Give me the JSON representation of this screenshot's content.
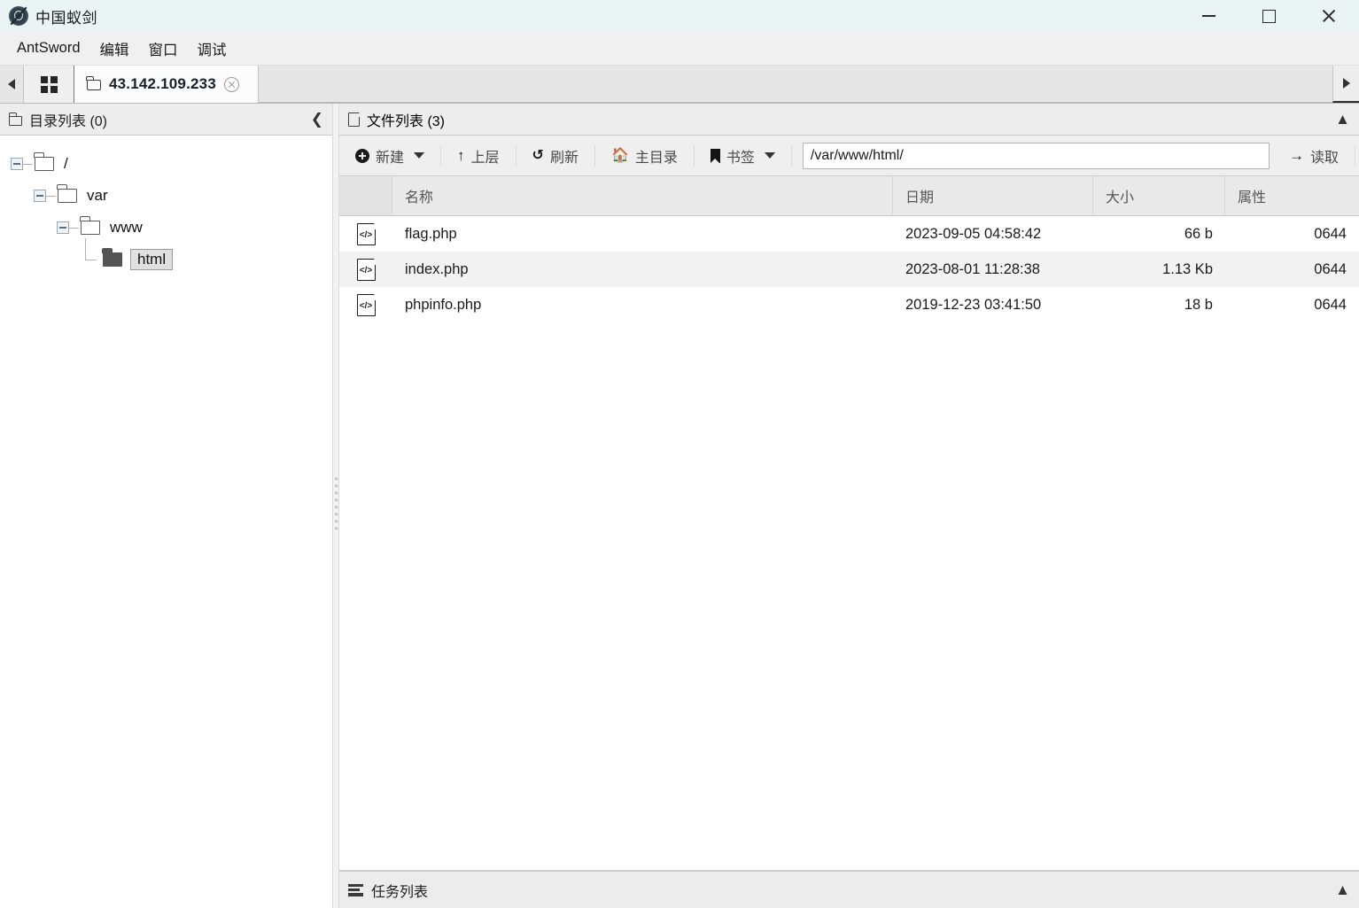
{
  "window": {
    "title": "中国蚁剑",
    "app_icon": "antsword-logo-icon",
    "minimize_label": "最小化",
    "maximize_label": "最大化",
    "close_label": "关闭"
  },
  "menubar": {
    "items": [
      {
        "label": "AntSword"
      },
      {
        "label": "编辑"
      },
      {
        "label": "窗口"
      },
      {
        "label": "调试"
      }
    ]
  },
  "tabbar": {
    "scroll_left_icon": "triangle-left-icon",
    "scroll_right_icon": "triangle-right-icon",
    "grid_icon": "grid-view-icon",
    "tabs": [
      {
        "label": "43.142.109.233",
        "icon": "folder-icon",
        "close_icon": "close-circle-icon",
        "active": true
      }
    ]
  },
  "left_panel": {
    "icon": "folder-icon",
    "title": "目录列表 (0)",
    "collapse_icon": "chevron-left-icon",
    "tree": [
      {
        "label": "/",
        "depth": 0,
        "expanded": true,
        "selected": false
      },
      {
        "label": "var",
        "depth": 1,
        "expanded": true,
        "selected": false
      },
      {
        "label": "www",
        "depth": 2,
        "expanded": true,
        "selected": false
      },
      {
        "label": "html",
        "depth": 3,
        "expanded": false,
        "selected": true
      }
    ]
  },
  "right_panel": {
    "icon": "document-icon",
    "title": "文件列表 (3)",
    "collapse_icon": "chevron-up-icon",
    "toolbar": {
      "new_label": "新建",
      "new_icon": "plus-circle-icon",
      "new_caret_icon": "caret-down-icon",
      "up_label": "上层",
      "up_icon": "arrow-up-icon",
      "refresh_label": "刷新",
      "refresh_icon": "refresh-icon",
      "home_label": "主目录",
      "home_icon": "home-icon",
      "bookmark_label": "书签",
      "bookmark_icon": "bookmark-icon",
      "bookmark_caret_icon": "caret-down-icon",
      "read_label": "读取",
      "read_icon": "arrow-right-icon",
      "path_value": "/var/www/html/",
      "path_placeholder": "/var/www/html/"
    },
    "table": {
      "columns": [
        {
          "key": "name",
          "label": "名称"
        },
        {
          "key": "date",
          "label": "日期"
        },
        {
          "key": "size",
          "label": "大小"
        },
        {
          "key": "attr",
          "label": "属性"
        }
      ],
      "rows": [
        {
          "icon": "php-file-icon",
          "name": "flag.php",
          "date": "2023-09-05 04:58:42",
          "size": "66 b",
          "attr": "0644"
        },
        {
          "icon": "php-file-icon",
          "name": "index.php",
          "date": "2023-08-01 11:28:38",
          "size": "1.13 Kb",
          "attr": "0644"
        },
        {
          "icon": "php-file-icon",
          "name": "phpinfo.php",
          "date": "2019-12-23 03:41:50",
          "size": "18 b",
          "attr": "0644"
        }
      ]
    }
  },
  "taskbar": {
    "icon": "list-icon",
    "title": "任务列表",
    "collapse_icon": "chevron-up-icon"
  },
  "colors": {
    "titlebar_bg": "#eaf4f4",
    "menubar_bg": "#f0f0f0",
    "panel_header_bg": "#ededed",
    "toolbar_bg": "#efefef",
    "row_alt_bg": "#f2f2f2",
    "tab_active_bg": "#fcfcfc"
  }
}
